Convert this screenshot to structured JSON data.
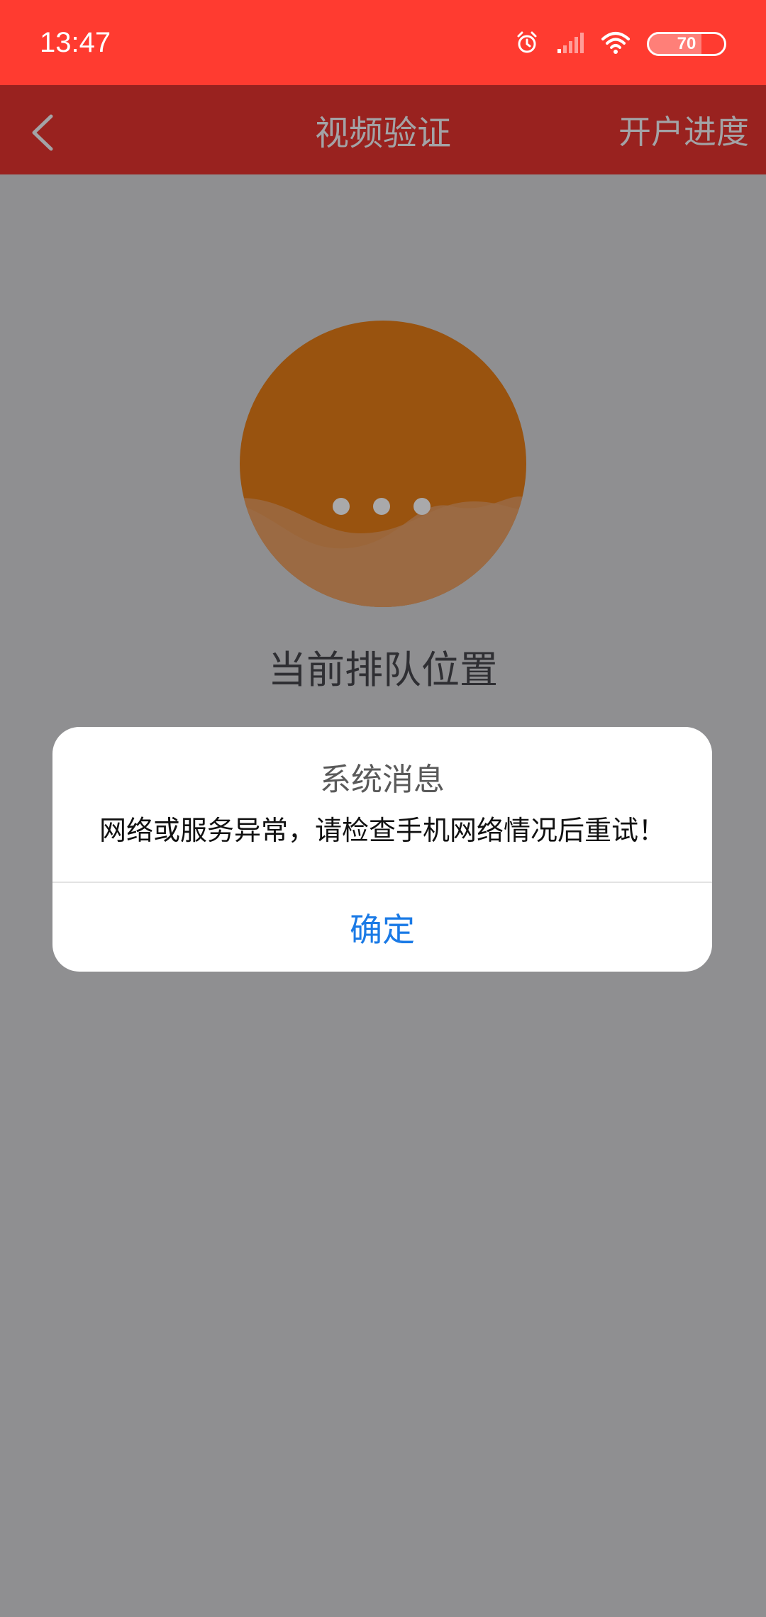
{
  "status_bar": {
    "time": "13:47",
    "battery_level": "70",
    "icons": [
      "alarm-icon",
      "cellular-signal-icon",
      "wifi-icon",
      "battery-icon"
    ]
  },
  "nav_bar": {
    "back_icon": "chevron-left-icon",
    "title": "视频验证",
    "right_action": "开户进度"
  },
  "main": {
    "queue_label": "当前排队位置"
  },
  "dialog": {
    "title": "系统消息",
    "message": "网络或服务异常，请检查手机网络情况后重试！",
    "confirm_label": "确定"
  },
  "colors": {
    "status_bar_bg": "#ff3b30",
    "nav_bar_bg": "#99221f",
    "overlay_bg": "#8f8f91",
    "circle_fill": "#99530f",
    "link_blue": "#1a7ae6"
  }
}
